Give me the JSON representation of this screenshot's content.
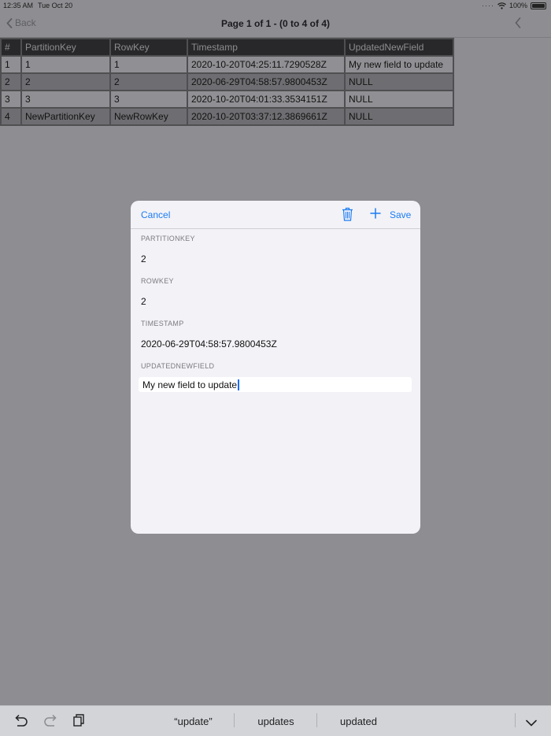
{
  "status": {
    "time": "12:35 AM",
    "date": "Tue Oct 20",
    "battery": "100%",
    "signal_dots": "····"
  },
  "nav": {
    "back_label": "Back",
    "title": "Page 1 of 1 - (0 to 4 of 4)"
  },
  "table": {
    "columns": [
      "#",
      "PartitionKey",
      "RowKey",
      "Timestamp",
      "UpdatedNewField"
    ],
    "rows": [
      [
        "1",
        "1",
        "1",
        "2020-10-20T04:25:11.7290528Z",
        "My new field to update"
      ],
      [
        "2",
        "2",
        "2",
        "2020-06-29T04:58:57.9800453Z",
        "NULL"
      ],
      [
        "3",
        "3",
        "3",
        "2020-10-20T04:01:33.3534151Z",
        "NULL"
      ],
      [
        "4",
        "NewPartitionKey",
        "NewRowKey",
        "2020-10-20T03:37:12.3869661Z",
        "NULL"
      ]
    ]
  },
  "editor": {
    "cancel_label": "Cancel",
    "save_label": "Save",
    "fields": [
      {
        "label": "PARTITIONKEY",
        "value": "2"
      },
      {
        "label": "ROWKEY",
        "value": "2"
      },
      {
        "label": "TIMESTAMP",
        "value": "2020-06-29T04:58:57.9800453Z"
      },
      {
        "label": "UPDATEDNEWFIELD",
        "value": "My new field to update"
      }
    ]
  },
  "keyboard": {
    "suggestions": [
      "“update”",
      "updates",
      "updated"
    ]
  },
  "colors": {
    "accent": "#1b7cf3",
    "header_bg": "#28282b",
    "row_light": "#909094",
    "row_dark": "#6e6e72",
    "backdrop": "#8e8e92"
  },
  "icons": [
    "wifi-icon",
    "battery-icon",
    "chevron-left-icon",
    "trash-icon",
    "plus-icon",
    "undo-icon",
    "redo-icon",
    "clipboard-icon",
    "chevron-down-icon"
  ]
}
